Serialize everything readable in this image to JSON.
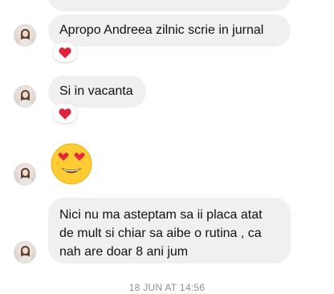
{
  "messages": [
    {
      "text": "Apropo Andreea zilnic scrie in jurnal",
      "reaction": "heart-icon"
    },
    {
      "text": "Si in vacanta",
      "reaction": "heart-icon"
    },
    {
      "emoji": "heart-eyes-emoji"
    },
    {
      "text": "Nici nu ma asteptam sa ii placa atat de mult si chiar sa aibe o rutina , ca nah are doar 8 ani jum"
    }
  ],
  "timestamp": "18 JUN AT 14:56",
  "colors": {
    "bubble_background": "#f0f0f0",
    "bubble_text": "#111111",
    "reaction_heart": "#e0223c",
    "timestamp_text": "#8e8e93",
    "emoji_face": "#ffcc33"
  }
}
